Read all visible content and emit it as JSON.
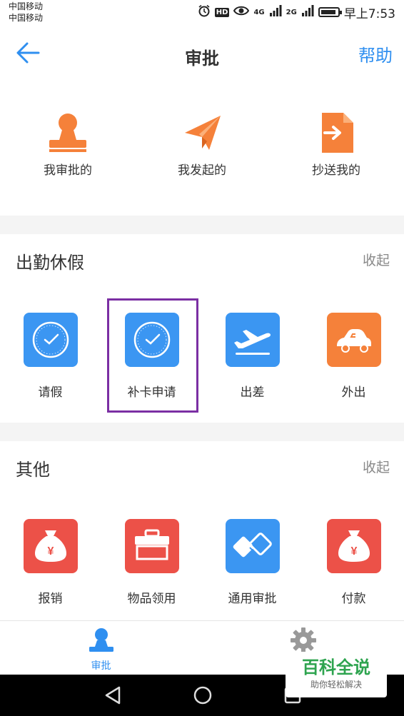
{
  "status_bar": {
    "carrier_1": "中国移动",
    "carrier_2": "中国移动",
    "network_1": "4G",
    "network_2": "2G",
    "hd": "HD",
    "time": "早上7:53"
  },
  "header": {
    "title": "审批",
    "help": "帮助"
  },
  "top_row": [
    {
      "label": "我审批的",
      "icon": "stamp-icon"
    },
    {
      "label": "我发起的",
      "icon": "paper-plane-icon"
    },
    {
      "label": "抄送我的",
      "icon": "cc-document-icon"
    }
  ],
  "sections": [
    {
      "title": "出勤休假",
      "collapse": "收起",
      "items": [
        {
          "label": "请假",
          "icon": "clock-icon",
          "color": "#3b96f2"
        },
        {
          "label": "补卡申请",
          "icon": "clock-icon",
          "color": "#3b96f2"
        },
        {
          "label": "出差",
          "icon": "airplane-icon",
          "color": "#3b96f2"
        },
        {
          "label": "外出",
          "icon": "car-icon",
          "color": "#f5813a"
        }
      ]
    },
    {
      "title": "其他",
      "collapse": "收起",
      "items": [
        {
          "label": "报销",
          "icon": "money-bag-icon",
          "color": "#ec5148"
        },
        {
          "label": "物品领用",
          "icon": "toolbox-icon",
          "color": "#ec5148"
        },
        {
          "label": "通用审批",
          "icon": "handshake-icon",
          "color": "#3b96f2"
        },
        {
          "label": "付款",
          "icon": "money-bag-icon",
          "color": "#ec5148"
        }
      ]
    }
  ],
  "tab_bar": {
    "tabs": [
      {
        "label": "审批",
        "icon": "person-icon",
        "active": true
      },
      {
        "label": "",
        "icon": "gear-icon",
        "active": false
      }
    ]
  },
  "watermark": {
    "main": "百科全说",
    "sub": "助你轻松解决"
  },
  "colors": {
    "accent": "#2f8ff0",
    "orange": "#f5813a",
    "red": "#ec5148",
    "highlight": "#7b2fa3"
  }
}
